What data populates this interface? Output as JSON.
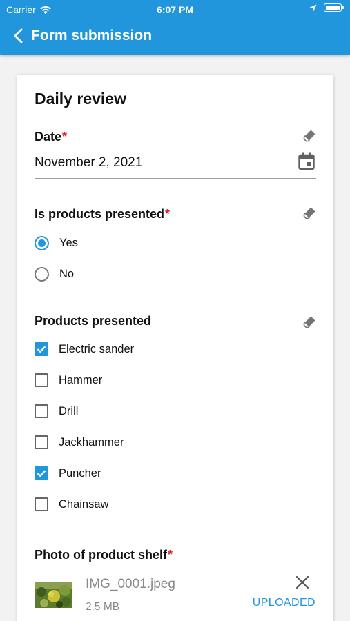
{
  "status_bar": {
    "carrier": "Carrier",
    "time": "6:07 PM"
  },
  "nav": {
    "title": "Form submission"
  },
  "form": {
    "title": "Daily review",
    "date_field": {
      "label": "Date",
      "required_mark": "*",
      "value": "November 2, 2021"
    },
    "presented_field": {
      "label": "Is products presented",
      "required_mark": "*",
      "options": [
        {
          "label": "Yes",
          "selected": true
        },
        {
          "label": "No",
          "selected": false
        }
      ]
    },
    "products_field": {
      "label": "Products presented",
      "options": [
        {
          "label": "Electric sander",
          "checked": true
        },
        {
          "label": "Hammer",
          "checked": false
        },
        {
          "label": "Drill",
          "checked": false
        },
        {
          "label": "Jackhammer",
          "checked": false
        },
        {
          "label": "Puncher",
          "checked": true
        },
        {
          "label": "Chainsaw",
          "checked": false
        }
      ]
    },
    "photo_field": {
      "label": "Photo of product shelf",
      "required_mark": "*",
      "file": {
        "name": "IMG_0001.jpeg",
        "size": "2.5 MB",
        "status": "UPLOADED"
      }
    }
  },
  "colors": {
    "accent": "#2196dd",
    "required": "#e02424"
  }
}
